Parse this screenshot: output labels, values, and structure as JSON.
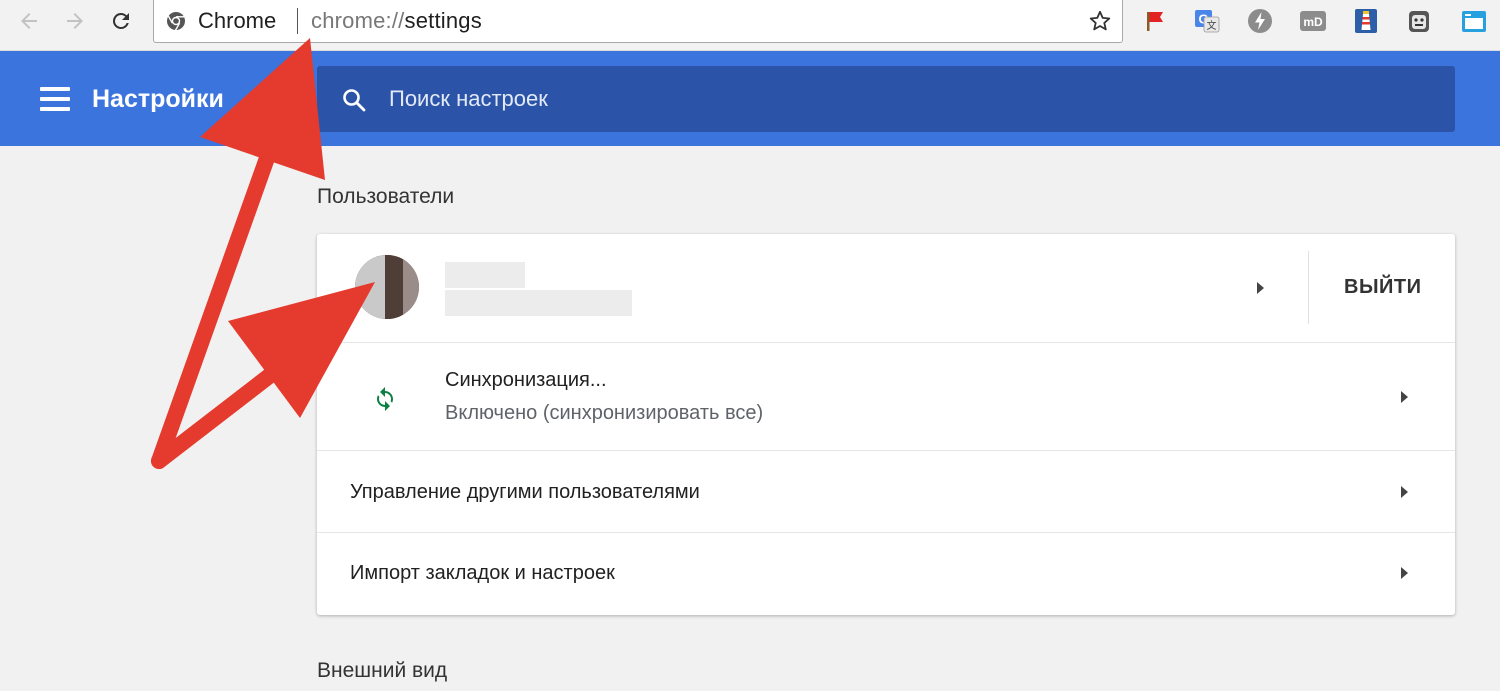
{
  "browser": {
    "chip_label": "Chrome",
    "url_scheme": "chrome://",
    "url_host": "settings",
    "extension_icons": [
      "red-flag-icon",
      "google-translate-icon",
      "lightning-icon",
      "md-icon",
      "lighthouse-icon",
      "face-icon",
      "window-icon"
    ]
  },
  "header": {
    "title": "Настройки",
    "search_placeholder": "Поиск настроек",
    "color": "#3b74dc"
  },
  "users_section": {
    "title": "Пользователи",
    "account": {
      "signout_label": "ВЫЙТИ"
    },
    "sync": {
      "label": "Синхронизация...",
      "status": "Включено (синхронизировать все)",
      "icon_color": "#0b8043"
    },
    "manage_users_label": "Управление другими пользователями",
    "import_label": "Импорт закладок и настроек"
  },
  "appearance_section": {
    "title": "Внешний вид"
  },
  "annotation": {
    "arrow_color": "#e53a2e"
  }
}
